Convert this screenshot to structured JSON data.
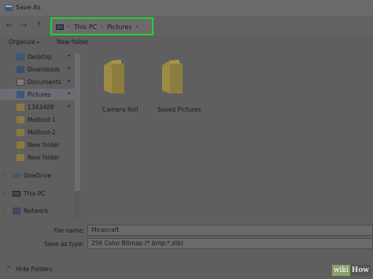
{
  "window": {
    "title": "Save As"
  },
  "navigation": {
    "back_icon": "arrow-left-icon",
    "forward_icon": "arrow-right-icon",
    "up_icon": "arrow-up-icon",
    "breadcrumb": [
      "This PC",
      "Pictures"
    ],
    "highlight_color": "#25d12d"
  },
  "toolbar": {
    "organize": "Organize",
    "new_folder": "New folder"
  },
  "sidebar": {
    "items": [
      {
        "label": "Desktop",
        "icon": "desktop-icon"
      },
      {
        "label": "Downloads",
        "icon": "download-icon"
      },
      {
        "label": "Documents",
        "icon": "document-icon"
      },
      {
        "label": "Pictures",
        "icon": "pictures-icon"
      },
      {
        "label": "1343408",
        "icon": "folder-icon"
      },
      {
        "label": "Mathod-1",
        "icon": "folder-icon"
      },
      {
        "label": "Mathod-2",
        "icon": "folder-icon"
      },
      {
        "label": "New folder",
        "icon": "folder-icon"
      },
      {
        "label": "New folder",
        "icon": "folder-icon"
      },
      {
        "label": "OneDrive",
        "icon": "cloud-icon"
      },
      {
        "label": "This PC",
        "icon": "computer-icon"
      },
      {
        "label": "Network",
        "icon": "network-icon"
      }
    ]
  },
  "content": {
    "folders": [
      {
        "name": "Camera Roll"
      },
      {
        "name": "Saved Pictures"
      }
    ]
  },
  "form": {
    "file_name_label": "File name:",
    "file_name_value": "Minecraft",
    "save_type_label": "Save as type:",
    "save_type_value": "256 Color Bitmap (*.bmp;*.dib)"
  },
  "footer": {
    "hide_folders": "Hide Folders"
  },
  "watermark": {
    "wiki": "wiki",
    "how": "How"
  }
}
